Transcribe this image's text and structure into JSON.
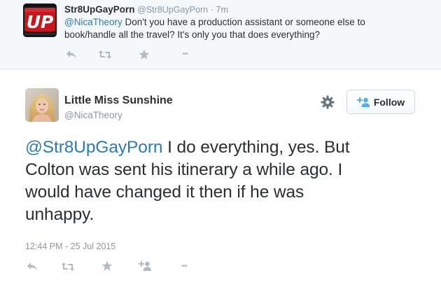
{
  "reply_tweet": {
    "avatar_text": "UP",
    "name": "Str8UpGayPorn",
    "handle": "@Str8UpGayPorn",
    "separator": "·",
    "time": "7m",
    "mention": "@NicaTheory",
    "text_line1": " Don't you have a production assistant or someone else to",
    "text_line2": "book/handle all the travel? It's only you that does everything?",
    "actions": {
      "reply_icon": "reply-arrow",
      "retweet_icon": "retweet-arrows",
      "favorite_icon": "star",
      "more_icon": "ellipsis",
      "more_glyph": "•••"
    }
  },
  "main_tweet": {
    "name": "Little Miss Sunshine",
    "handle": "@NicaTheory",
    "follow_label": "Follow",
    "mention": "@Str8UpGayPorn",
    "text_line1": " I do everything, yes. But",
    "text_line2": "Colton was sent his itinerary a while ago. I",
    "text_line3": "would have changed it then if he was",
    "text_line4": "unhappy.",
    "timestamp": "12:44 PM - 25 Jul 2015",
    "actions": {
      "reply_icon": "reply-arrow",
      "retweet_icon": "retweet-arrows",
      "favorite_icon": "star",
      "follow_icon": "add-user",
      "more_icon": "ellipsis",
      "more_glyph": "•••"
    }
  },
  "colors": {
    "link": "#2b7bb9",
    "text": "#292f33",
    "muted": "#8899a6",
    "icon": "#b0bcc5",
    "reply_bg": "#f5f8fa",
    "follow_accent": "#55acee"
  }
}
